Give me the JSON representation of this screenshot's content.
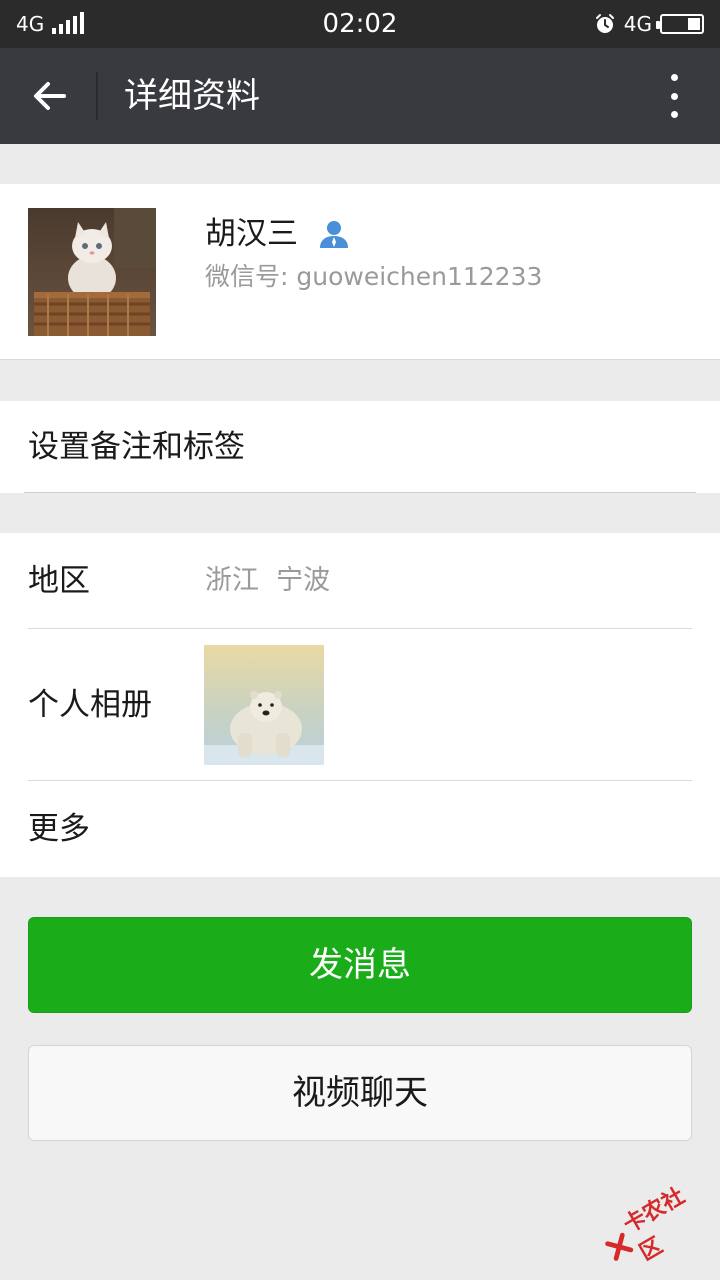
{
  "status_bar": {
    "network_left": "4G",
    "time": "02:02",
    "network_right": "4G"
  },
  "header": {
    "title": "详细资料"
  },
  "profile": {
    "name": "胡汉三",
    "wechat_id": "微信号: guoweichen112233"
  },
  "remark": {
    "label": "设置备注和标签"
  },
  "info": {
    "region_label": "地区",
    "region_value": "浙江  宁波",
    "album_label": "个人相册",
    "more_label": "更多"
  },
  "actions": {
    "send_message": "发消息",
    "video_chat": "视频聊天"
  },
  "watermark": {
    "text": "卡农社区"
  },
  "colors": {
    "primary_green": "#1aad19",
    "titlebar": "#393a3f",
    "statusbar": "#2b2b2b",
    "background": "#ebebeb"
  }
}
